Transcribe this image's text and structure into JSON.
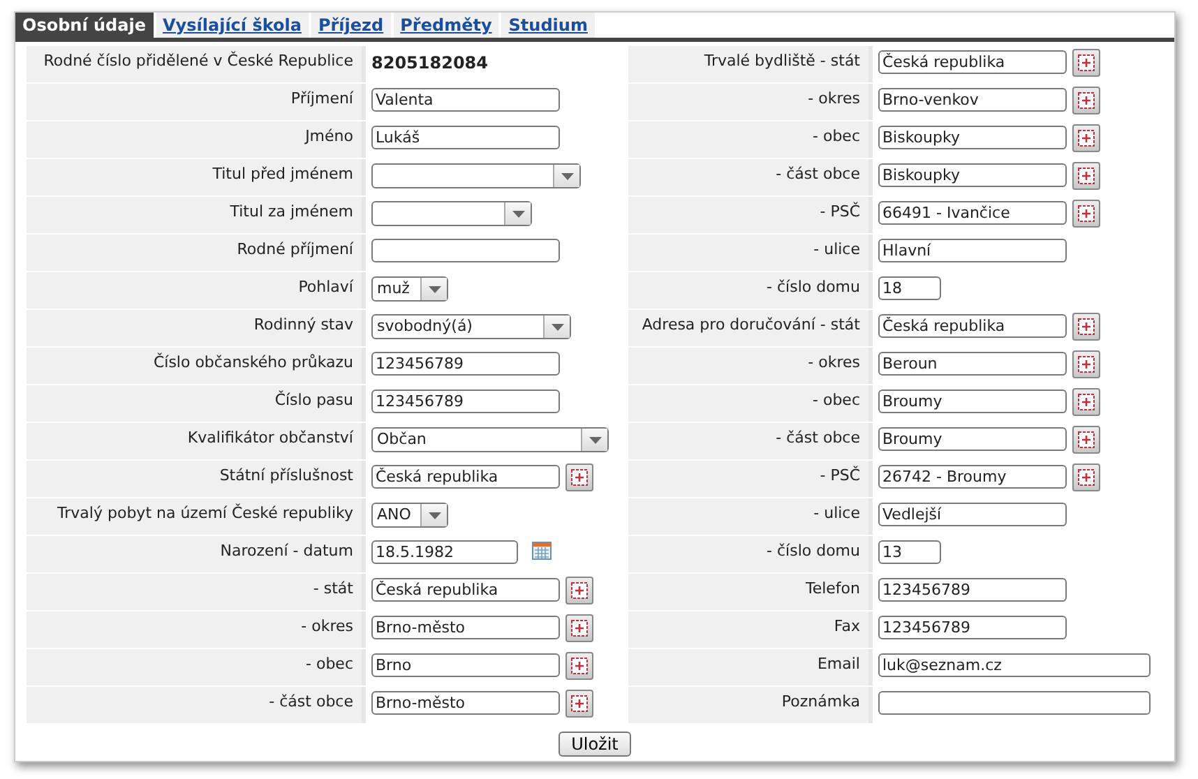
{
  "tabs": [
    {
      "label": "Osobní údaje",
      "selected": true
    },
    {
      "label": "Vysílající škola",
      "selected": false
    },
    {
      "label": "Příjezd",
      "selected": false
    },
    {
      "label": "Předměty",
      "selected": false
    },
    {
      "label": "Studium",
      "selected": false
    }
  ],
  "left_fields": [
    {
      "label": "Rodné číslo přidělené v České Republice",
      "kind": "static",
      "value": "8205182084"
    },
    {
      "label": "Příjmení",
      "kind": "text",
      "value": "Valenta"
    },
    {
      "label": "Jméno",
      "kind": "text",
      "value": "Lukáš"
    },
    {
      "label": "Titul před jménem",
      "kind": "select"
    },
    {
      "label": "Titul za jménem",
      "kind": "select"
    },
    {
      "label": "Rodné příjmení",
      "kind": "text"
    },
    {
      "label": "Pohlaví",
      "kind": "select",
      "value": "muž"
    },
    {
      "label": "Rodinný stav",
      "kind": "select",
      "value": "svobodný(á)"
    },
    {
      "label": "Číslo občanského průkazu",
      "kind": "text",
      "value": "123456789"
    },
    {
      "label": "Číslo pasu",
      "kind": "text",
      "value": "123456789"
    },
    {
      "label": "Kvalifikátor občanství",
      "kind": "select",
      "value": "Občan"
    },
    {
      "label": "Státní příslušnost",
      "kind": "lookup",
      "value": "Česká republika"
    },
    {
      "label": "Trvalý pobyt na území České republiky",
      "kind": "select",
      "value": "ANO"
    },
    {
      "label": "Narození - datum",
      "kind": "date",
      "value": "18.5.1982"
    },
    {
      "label": "- stát",
      "kind": "lookup",
      "value": "Česká republika"
    },
    {
      "label": "- okres",
      "kind": "lookup",
      "value": "Brno-město"
    },
    {
      "label": "- obec",
      "kind": "lookup",
      "value": "Brno"
    },
    {
      "label": "- část obce",
      "kind": "lookup",
      "value": "Brno-město"
    }
  ],
  "right_fields": [
    {
      "label": "Trvalé bydliště - stát",
      "kind": "lookup",
      "value": "Česká republika"
    },
    {
      "label": "- okres",
      "kind": "lookup",
      "value": "Brno-venkov"
    },
    {
      "label": "- obec",
      "kind": "lookup",
      "value": "Biskoupky"
    },
    {
      "label": "- část obce",
      "kind": "lookup",
      "value": "Biskoupky"
    },
    {
      "label": "- PSČ",
      "kind": "lookup",
      "value": "66491 - Ivančice"
    },
    {
      "label": "- ulice",
      "kind": "text",
      "value": "Hlavní"
    },
    {
      "label": "- číslo domu",
      "kind": "text",
      "value": "18"
    },
    {
      "label": "Adresa pro doručování - stát",
      "kind": "lookup",
      "value": "Česká republika"
    },
    {
      "label": "- okres",
      "kind": "lookup",
      "value": "Beroun"
    },
    {
      "label": "- obec",
      "kind": "lookup",
      "value": "Broumy"
    },
    {
      "label": "- část obce",
      "kind": "lookup",
      "value": "Broumy"
    },
    {
      "label": "- PSČ",
      "kind": "lookup",
      "value": "26742 - Broumy"
    },
    {
      "label": "- ulice",
      "kind": "text",
      "value": "Vedlejší"
    },
    {
      "label": "- číslo domu",
      "kind": "text",
      "value": "13"
    },
    {
      "label": "Telefon",
      "kind": "text",
      "value": "123456789"
    },
    {
      "label": "Fax",
      "kind": "text",
      "value": "123456789"
    },
    {
      "label": "Email",
      "kind": "text",
      "value": "luk@seznam.cz"
    },
    {
      "label": "Poznámka",
      "kind": "text"
    }
  ],
  "save_button": "Uložit"
}
